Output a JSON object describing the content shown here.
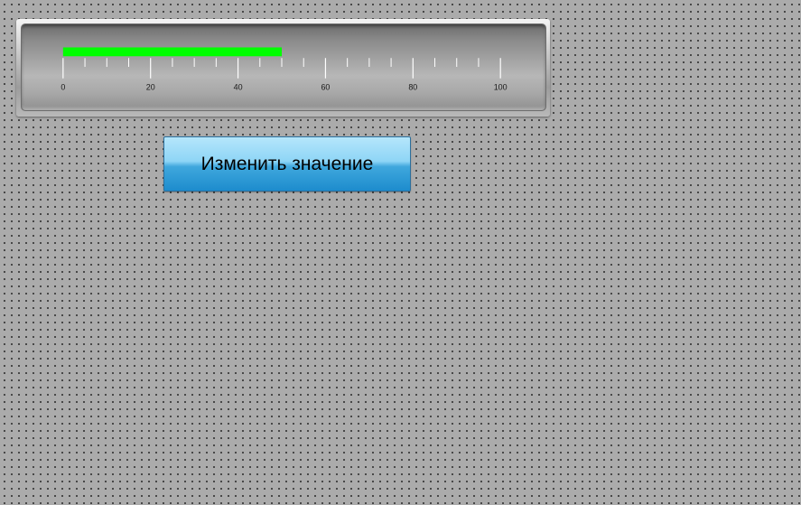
{
  "progress": {
    "value": 50,
    "min": 0,
    "max": 100,
    "tick_labels": [
      "0",
      "20",
      "40",
      "60",
      "80",
      "100"
    ],
    "fill_color": "#00ff00"
  },
  "button": {
    "label": "Изменить значение"
  }
}
